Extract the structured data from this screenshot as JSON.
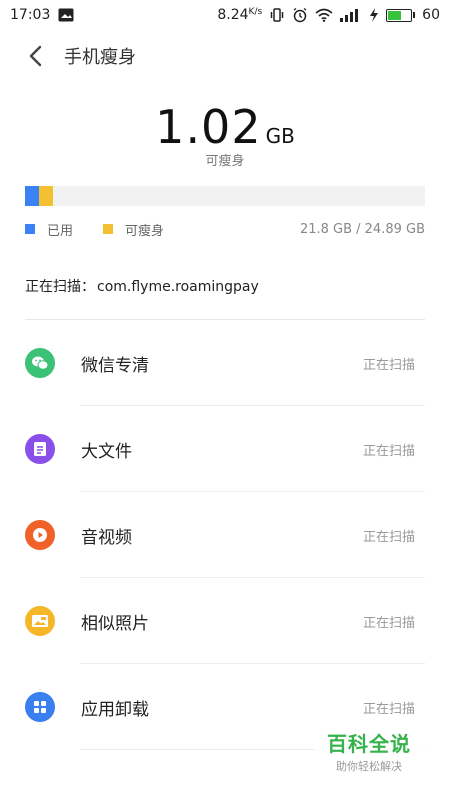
{
  "status_bar": {
    "time": "17:03",
    "net_speed": "8.24",
    "net_unit": "K/s",
    "battery": "60"
  },
  "header": {
    "back_icon": "chevron-left-icon",
    "title": "手机瘦身"
  },
  "summary": {
    "size_value": "1.02",
    "size_unit": "GB",
    "caption": "可瘦身"
  },
  "storage": {
    "used_fraction": 0.035,
    "slimmable_fraction": 0.035,
    "legend_used": "已用",
    "legend_slim": "可瘦身",
    "usage_text": "21.8 GB / 24.89 GB",
    "colors": {
      "used": "#3a82f6",
      "slim": "#f5bf32",
      "track": "#f2f2f2"
    }
  },
  "scan": {
    "label": "正在扫描：",
    "package": "com.flyme.roamingpay"
  },
  "list": [
    {
      "label": "微信专清",
      "status": "正在扫描",
      "icon": "wechat-icon",
      "color": "#3cc276"
    },
    {
      "label": "大文件",
      "status": "正在扫描",
      "icon": "document-icon",
      "color": "#8a4fe8"
    },
    {
      "label": "音视频",
      "status": "正在扫描",
      "icon": "play-icon",
      "color": "#f0612a"
    },
    {
      "label": "相似照片",
      "status": "正在扫描",
      "icon": "photo-icon",
      "color": "#f5b62a"
    },
    {
      "label": "应用卸载",
      "status": "正在扫描",
      "icon": "apps-grid-icon",
      "color": "#3a7ff0"
    }
  ],
  "watermark": {
    "title": "百科全说",
    "subtitle": "助你轻松解决"
  }
}
